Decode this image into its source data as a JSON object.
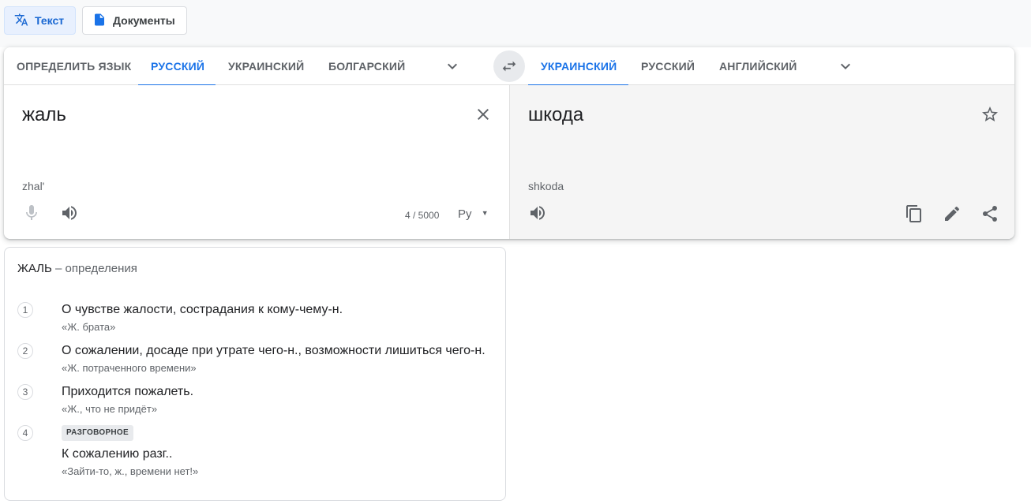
{
  "modes": [
    {
      "label": "Текст",
      "icon": "translate-icon",
      "active": true
    },
    {
      "label": "Документы",
      "icon": "document-icon",
      "active": false
    }
  ],
  "source_langs": [
    "ОПРЕДЕЛИТЬ ЯЗЫК",
    "РУССКИЙ",
    "УКРАИНСКИЙ",
    "БОЛГАРСКИЙ"
  ],
  "source_active_index": 1,
  "target_langs": [
    "УКРАИНСКИЙ",
    "РУССКИЙ",
    "АНГЛИЙСКИЙ"
  ],
  "target_active_index": 0,
  "source": {
    "text": "жаль",
    "transliteration": "zhal'",
    "counter": "4 / 5000",
    "input_tool_label": "Pу"
  },
  "target": {
    "text": "шкода",
    "transliteration": "shkoda"
  },
  "definitions": {
    "word": "ЖАЛЬ",
    "subtitle": "– определения",
    "items": [
      {
        "num": "1",
        "text": "О чувстве жалости, сострадания к кому-чему-н.",
        "example": "«Ж. брата»"
      },
      {
        "num": "2",
        "text": "О сожалении, досаде при утрате чего-н., возможности лишиться чего-н.",
        "example": "«Ж. потраченного времени»"
      },
      {
        "num": "3",
        "text": "Приходится пожалеть.",
        "example": "«Ж., что не придёт»"
      },
      {
        "num": "4",
        "badge": "РАЗГОВОРНОЕ",
        "text": "К сожалению разг..",
        "example": "«Зайти-то, ж., времени нет!»"
      }
    ]
  },
  "colors": {
    "accent": "#1a73e8",
    "active_mode_bg": "#e8f0fe",
    "target_bg": "#f5f5f5"
  }
}
